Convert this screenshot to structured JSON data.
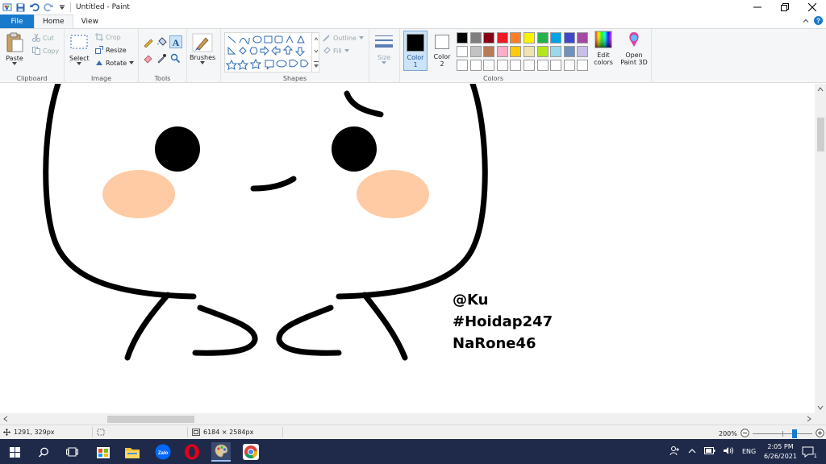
{
  "window": {
    "title": "Untitled - Paint"
  },
  "tabs": [
    {
      "label": "File"
    },
    {
      "label": "Home"
    },
    {
      "label": "View"
    }
  ],
  "ribbon": {
    "clipboard": {
      "label": "Clipboard",
      "paste": "Paste",
      "cut": "Cut",
      "copy": "Copy"
    },
    "image": {
      "label": "Image",
      "select": "Select",
      "crop": "Crop",
      "resize": "Resize",
      "rotate": "Rotate"
    },
    "tools": {
      "label": "Tools"
    },
    "brushes": {
      "label": "Brushes"
    },
    "shapes": {
      "label": "Shapes",
      "outline": "Outline",
      "fill": "Fill"
    },
    "size": {
      "label": "Size"
    },
    "colors": {
      "label": "Colors",
      "color1": "Color\n1",
      "color2": "Color\n2",
      "edit_colors": "Edit\ncolors",
      "open_paint3d": "Open\nPaint 3D",
      "color1_value": "#000000",
      "color2_value": "#ffffff",
      "palette_row1": [
        "#000000",
        "#7f7f7f",
        "#880015",
        "#ed1c24",
        "#ff7f27",
        "#fff200",
        "#22b14c",
        "#00a2e8",
        "#3f48cc",
        "#a349a4"
      ],
      "palette_row2": [
        "#ffffff",
        "#c3c3c3",
        "#b97a57",
        "#ffaec9",
        "#ffc90e",
        "#efe4b0",
        "#b5e61d",
        "#99d9ea",
        "#7092be",
        "#c8bfe7"
      ],
      "palette_row3": [
        "#ffffff",
        "#ffffff",
        "#ffffff",
        "#ffffff",
        "#ffffff",
        "#ffffff",
        "#ffffff",
        "#ffffff",
        "#ffffff",
        "#ffffff"
      ]
    }
  },
  "canvas": {
    "text_lines": [
      "@Ku",
      "#Hoidap247",
      "NaRone46"
    ],
    "blush_color": "#ffcba4"
  },
  "status": {
    "cursor_pos": "1291, 329px",
    "image_size": "6184 × 2584px",
    "zoom": "200%"
  },
  "taskbar": {
    "lang": "ENG",
    "time": "2:05 PM",
    "date": "6/26/2021",
    "notif_count": "1"
  }
}
